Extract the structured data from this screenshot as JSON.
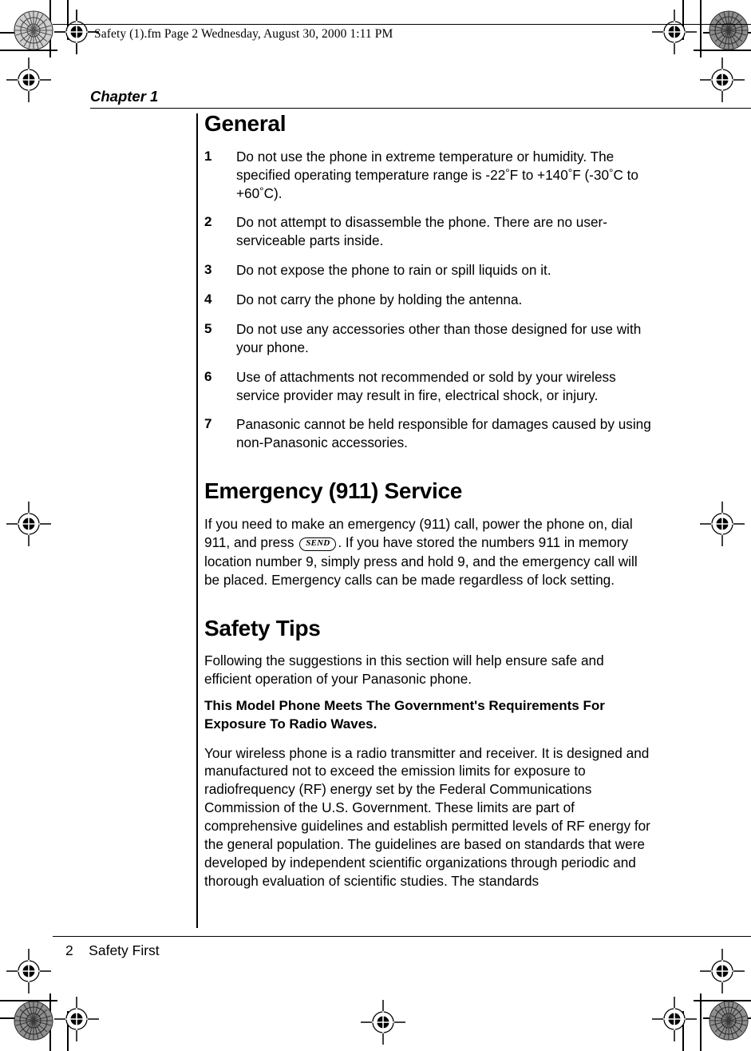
{
  "header": {
    "file_line": "Safety (1).fm  Page 2  Wednesday, August 30, 2000  1:11 PM"
  },
  "chapter": {
    "label": "Chapter 1"
  },
  "sections": {
    "general": {
      "title": "General",
      "items": [
        {
          "num": "1",
          "text_before": "Do not use the phone in extreme temperature or humidity. The specified operating temperature range is -22",
          "deg1": "°",
          "mid1": "F to +140",
          "deg2": "°",
          "mid2": "F (-30",
          "deg3": "°",
          "mid3": "C to +60",
          "deg4": "°",
          "text_after": "C)."
        },
        {
          "num": "2",
          "text": "Do not attempt to disassemble the phone. There are no user-serviceable parts inside."
        },
        {
          "num": "3",
          "text": "Do not expose the phone to rain or spill liquids on it."
        },
        {
          "num": "4",
          "text": "Do not carry the phone by holding the antenna."
        },
        {
          "num": "5",
          "text": "Do not use any accessories other than those designed for use with your phone."
        },
        {
          "num": "6",
          "text": "Use of attachments not recommended or sold by your wireless service provider may result in fire, electrical shock, or injury."
        },
        {
          "num": "7",
          "text": "Panasonic cannot be held responsible for damages caused by using non-Panasonic accessories."
        }
      ]
    },
    "emergency": {
      "title": "Emergency (911) Service",
      "para_before": "If you need to make an emergency (911) call, power the phone on, dial 911, and press",
      "send_key": "SEND",
      "para_after": ". If you have stored the numbers 911 in memory location number 9, simply press and hold 9, and the emergency call will be placed. Emergency calls can be made regardless of lock setting."
    },
    "safety_tips": {
      "title": "Safety Tips",
      "intro": "Following the suggestions in this section will help ensure safe and efficient operation of your Panasonic phone.",
      "subhead": "This Model Phone Meets The Government's Requirements For Exposure To Radio Waves.",
      "body": "Your wireless phone is a radio transmitter and receiver. It is designed and manufactured not to exceed the emission limits for exposure to radiofrequency (RF) energy set by the Federal Communications Commission of the U.S. Government. These limits are part of comprehensive guidelines and establish permitted levels of RF energy for the general population. The guidelines are based on standards that were developed by independent scientific organizations through periodic and thorough evaluation of scientific studies. The standards"
    }
  },
  "footer": {
    "page_number": "2",
    "section_name": "Safety First",
    "combined": "2    Safety First"
  },
  "print_marks": {
    "registration_label": "registration-target",
    "starburst_label": "density-starburst-target",
    "crop_label": "crop-mark"
  }
}
